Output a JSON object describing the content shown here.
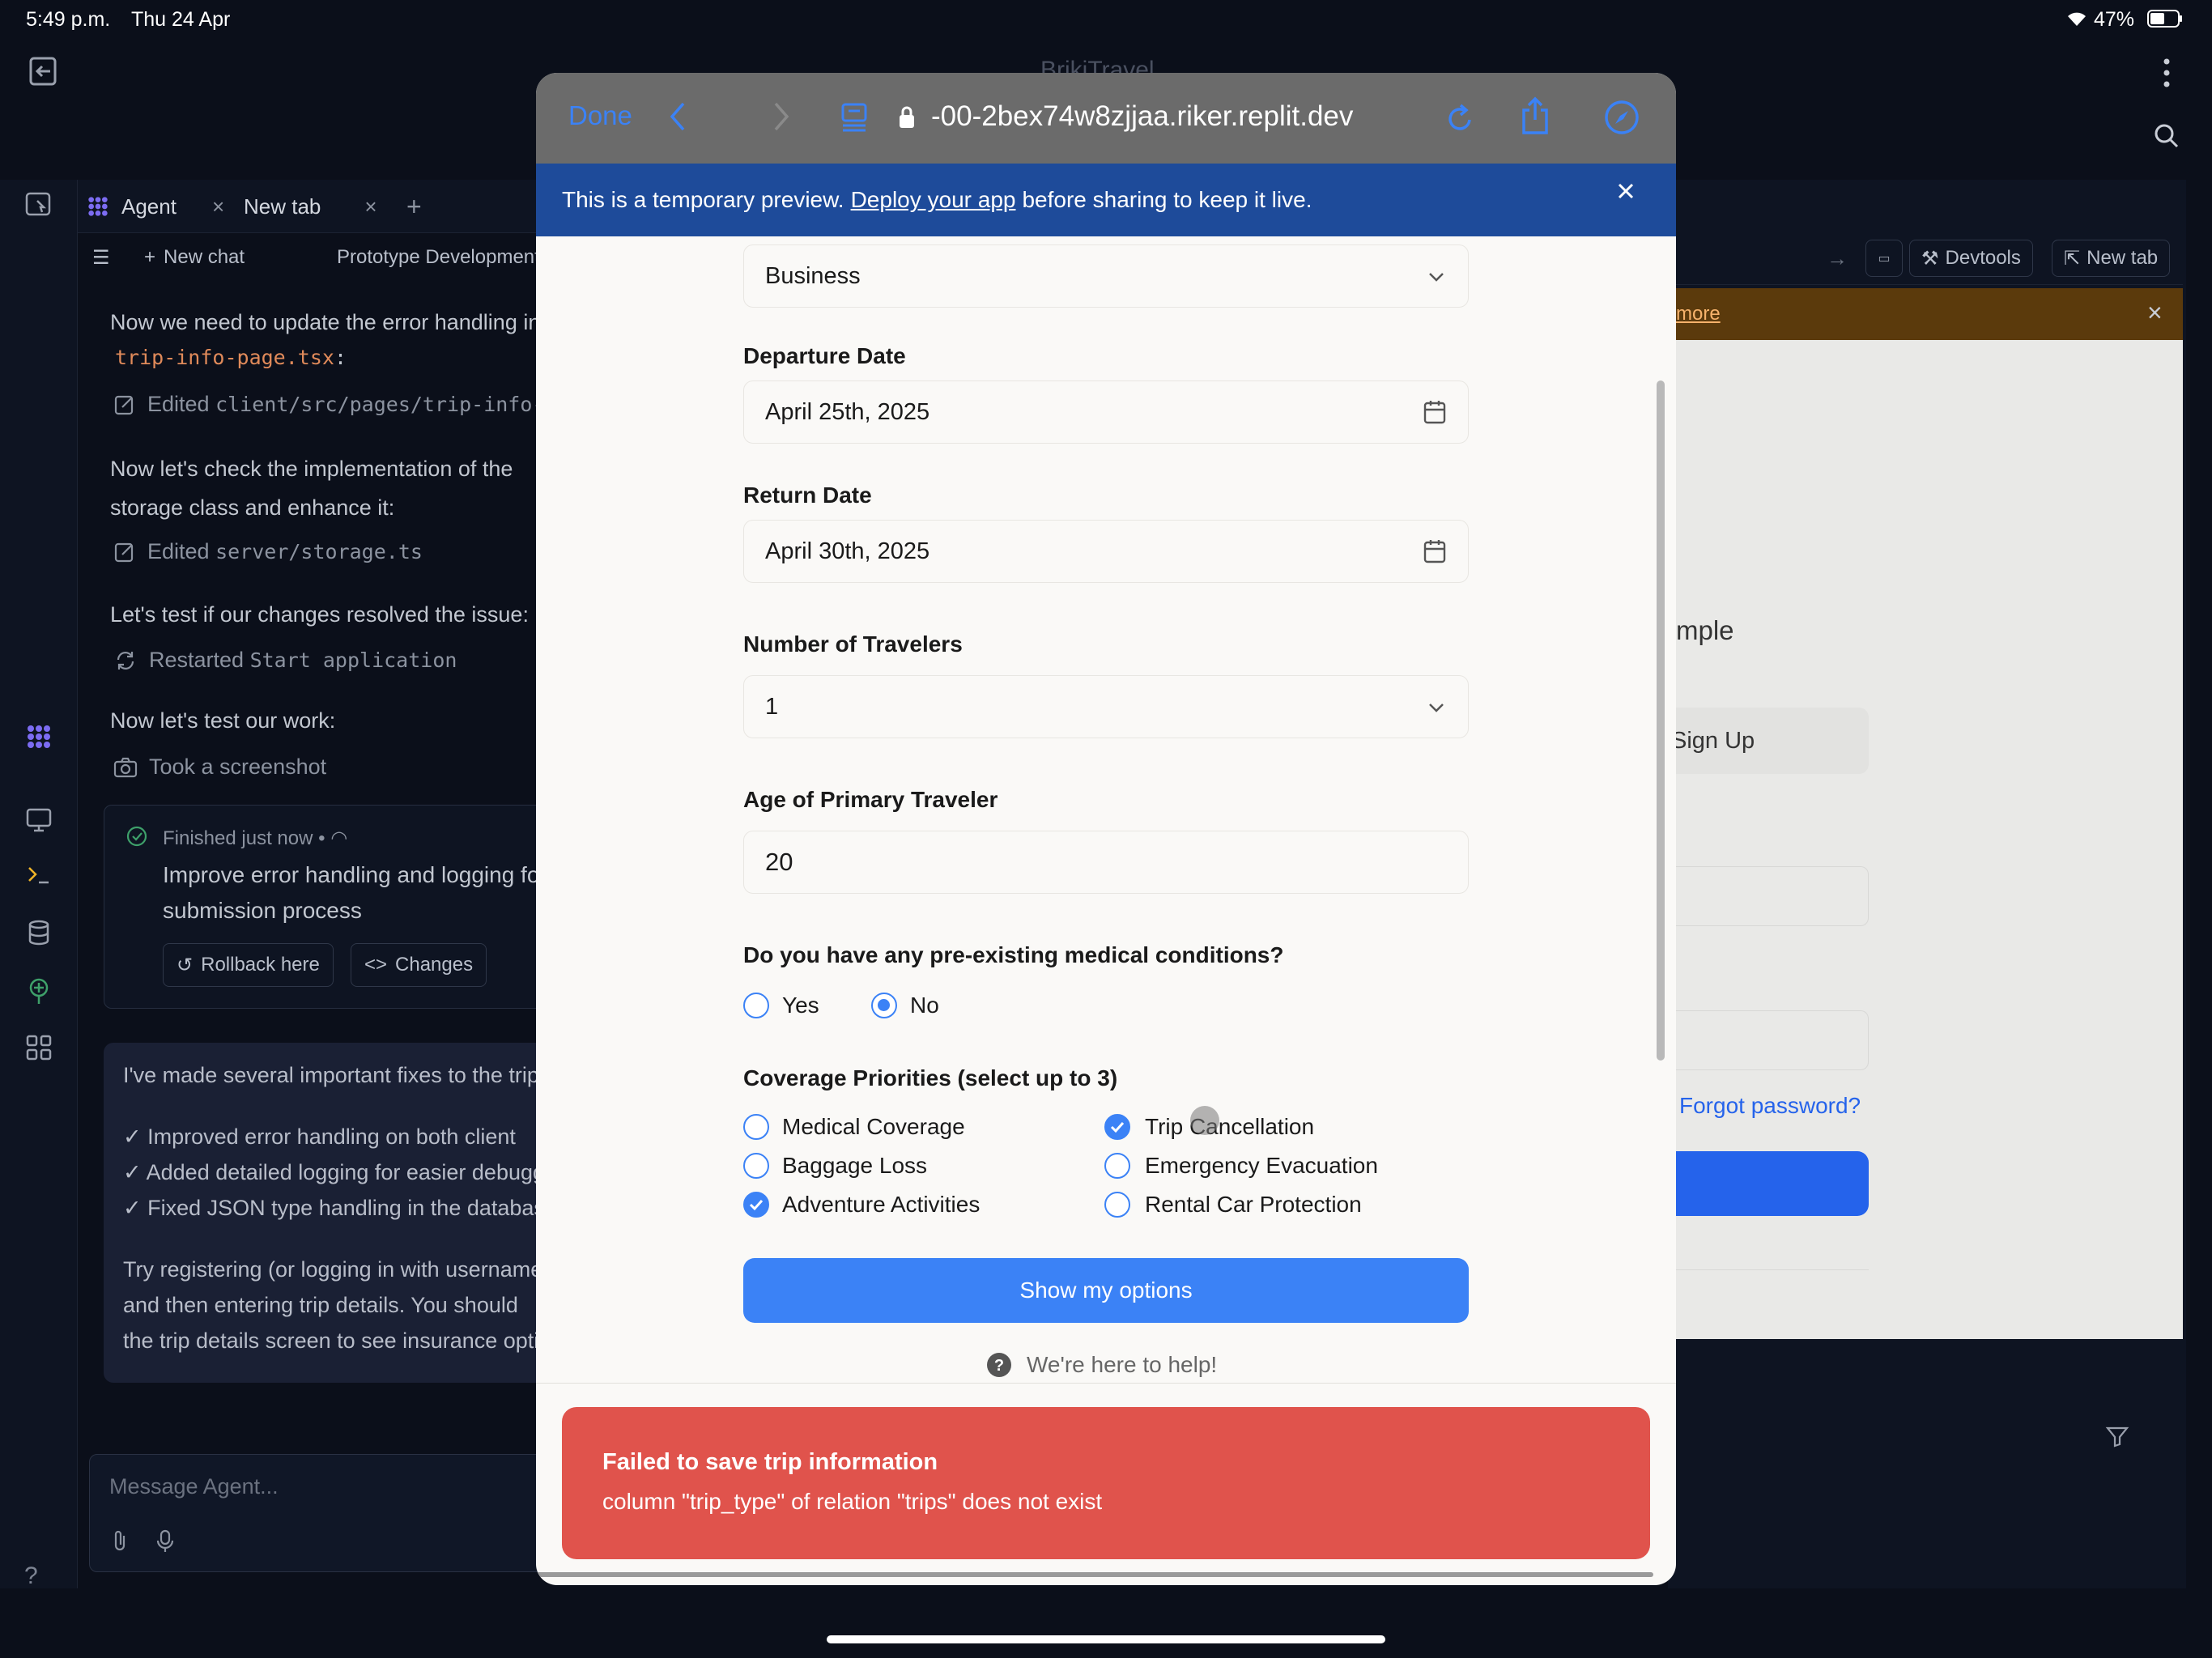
{
  "status_bar": {
    "time": "5:49 p.m.",
    "date": "Thu 24 Apr",
    "battery": "47%"
  },
  "app": {
    "title": "BrikiTravel"
  },
  "agent_tabs": [
    {
      "label": "Agent"
    },
    {
      "label": "New tab"
    }
  ],
  "agent_toolbar": {
    "new_chat": "New chat",
    "project": "Prototype Development"
  },
  "chat": {
    "m1_a": "Now we need to update the error handling in",
    "m1_b": "trip-info-page.tsx",
    "m1_c": ":",
    "act1_prefix": "Edited ",
    "act1_path": "client/src/pages/trip-info-page.tsx",
    "m2_a": "Now let's check the implementation of the",
    "m2_b": "storage class and enhance it:",
    "act2_prefix": "Edited ",
    "act2_path": "server/storage.ts",
    "m3": "Let's test if our changes resolved the issue:",
    "act3_prefix": "Restarted ",
    "act3_path": "Start application",
    "m4": "Now let's test our work:",
    "act4": "Took a screenshot",
    "card_status": "Finished just now",
    "card_title_a": "Improve error handling and logging for",
    "card_title_b": "submission process",
    "rollback": "Rollback here",
    "changes": "Changes",
    "summary_1": "I've made several important fixes to the trip",
    "summary_2": "✓ Improved error handling on both client",
    "summary_3": "✓ Added detailed logging for easier debugging",
    "summary_4": "✓ Fixed JSON type handling in the database",
    "summary_5": "Try registering (or logging in with username",
    "summary_6": "and then entering trip details. You should",
    "summary_7": "the trip details screen to see insurance options",
    "input_placeholder": "Message Agent..."
  },
  "right_panel": {
    "devtools": "Devtools",
    "new_tab": "New tab",
    "more": "more",
    "sample": "mple",
    "sign_up": "Sign Up",
    "forgot": "Forgot password?"
  },
  "browser": {
    "done": "Done",
    "url": "-00-2bex74w8zjjaa.riker.replit.dev",
    "banner_pre": "This is a temporary preview.",
    "banner_link": "Deploy your app",
    "banner_post": "before sharing to keep it live."
  },
  "form": {
    "trip_type_value": "Business",
    "departure_label": "Departure Date",
    "departure_value": "April 25th, 2025",
    "return_label": "Return Date",
    "return_value": "April 30th, 2025",
    "travelers_label": "Number of Travelers",
    "travelers_value": "1",
    "age_label": "Age of Primary Traveler",
    "age_value": "20",
    "medical_label": "Do you have any pre-existing medical conditions?",
    "medical_yes": "Yes",
    "medical_no": "No",
    "medical_selected": "No",
    "coverage_label": "Coverage Priorities (select up to 3)",
    "coverage_options": [
      {
        "label": "Medical Coverage",
        "checked": false
      },
      {
        "label": "Trip Cancellation",
        "checked": true
      },
      {
        "label": "Baggage Loss",
        "checked": false
      },
      {
        "label": "Emergency Evacuation",
        "checked": false
      },
      {
        "label": "Adventure Activities",
        "checked": true
      },
      {
        "label": "Rental Car Protection",
        "checked": false
      }
    ],
    "submit": "Show my options",
    "help": "We're here to help!"
  },
  "toast": {
    "title": "Failed to save trip information",
    "message": "column \"trip_type\" of relation \"trips\" does not exist"
  },
  "colors": {
    "accent": "#3b82f6",
    "toast": "#e0534c",
    "banner": "#1e4b9a",
    "toolbar": "#6b6b6b"
  }
}
